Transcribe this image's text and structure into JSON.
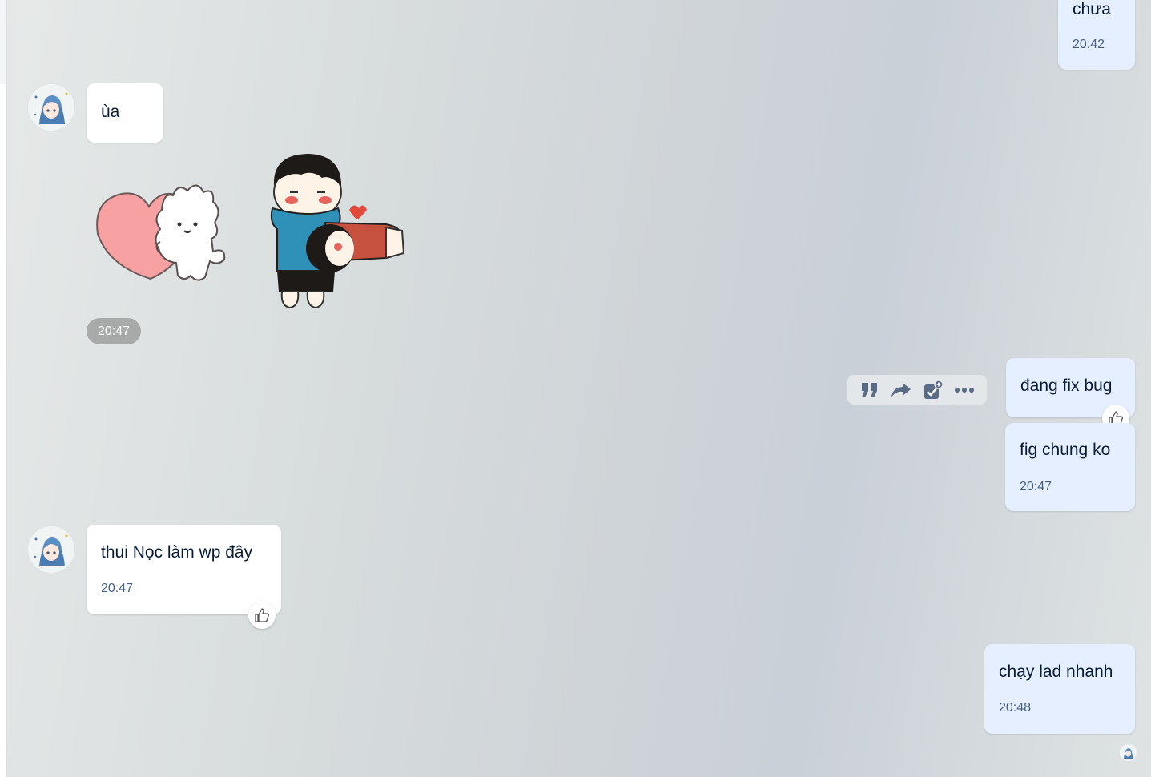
{
  "messages": {
    "m1": {
      "text": "chưa",
      "time": "20:42"
    },
    "m2": {
      "text": "ùa"
    },
    "sticker_group_time": "20:47",
    "m3": {
      "text": "đang fix bug"
    },
    "m4": {
      "text": "fig chung ko",
      "time": "20:47"
    },
    "m5": {
      "text": "thui Nọc làm wp đây",
      "time": "20:47"
    },
    "m6": {
      "text": "chạy lad nhanh",
      "time": "20:48"
    }
  },
  "toolbar": {
    "icons": [
      "quote-icon",
      "forward-icon",
      "task-icon",
      "more-icon"
    ]
  },
  "colors": {
    "incoming_bubble": "#ffffff",
    "outgoing_bubble": "#e5efff",
    "time_text": "#476285",
    "icon": "#5a6b85"
  }
}
